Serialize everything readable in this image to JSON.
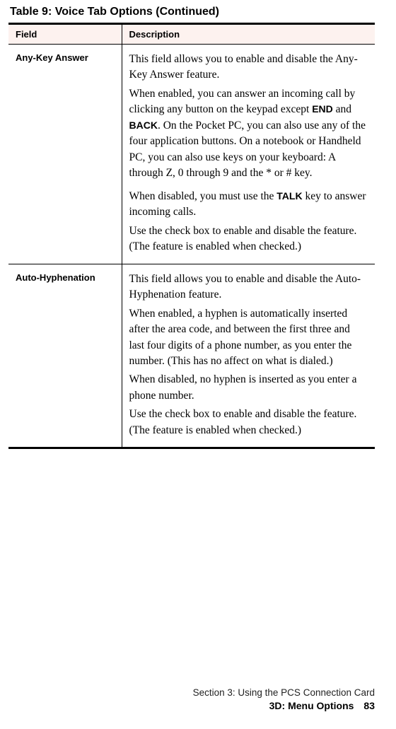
{
  "table": {
    "title": "Table 9: Voice Tab Options (Continued)",
    "headers": {
      "field": "Field",
      "description": "Description"
    },
    "rows": [
      {
        "field": "Any-Key Answer",
        "p1": "This field allows you to enable and disable the Any-Key Answer feature.",
        "p2a": "When enabled, you can answer an incoming call by clicking any button on the keypad except ",
        "kw_end": "END",
        "p2b": " and ",
        "kw_back": "BACK",
        "p2c": ". On the Pocket PC, you can also use any of the four application buttons. On a notebook or Handheld PC, you can also use keys on your keyboard: A through Z, 0 through 9 and the * or # key.",
        "p3a": "When disabled, you must use the ",
        "kw_talk": "TALK",
        "p3b": " key to answer incoming calls.",
        "p4": "Use the check box to enable and disable the feature. (The feature is enabled when checked.)"
      },
      {
        "field": "Auto-Hyphenation",
        "p1": "This field allows you to enable and disable the Auto-Hyphenation feature.",
        "p2": "When enabled, a hyphen is automatically inserted after the area code, and between the first three and last four digits of a phone number, as you enter the number. (This has no affect on what is dialed.)",
        "p3": "When disabled, no hyphen is inserted as you enter a phone number.",
        "p4": "Use the check box to enable and disable the feature. (The feature is enabled when checked.)"
      }
    ]
  },
  "footer": {
    "section": "Section 3: Using the PCS Connection Card",
    "breadcrumb": "3D: Menu Options",
    "page": "83"
  }
}
